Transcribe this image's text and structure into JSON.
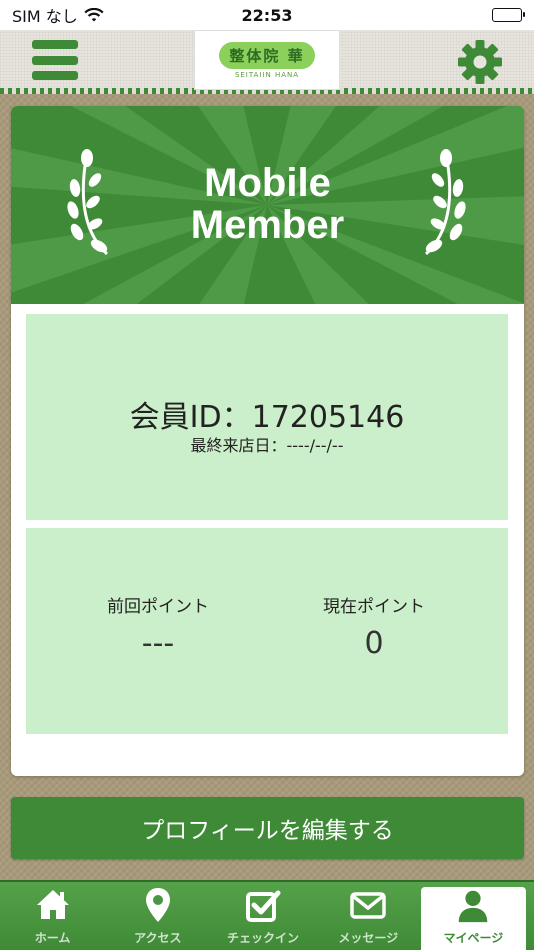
{
  "status_bar": {
    "carrier": "SIM なし",
    "time": "22:53"
  },
  "header": {
    "logo_text": "整体院 華",
    "logo_sub": "SEITAIIN HANA",
    "menu_icon": "hamburger-icon",
    "settings_icon": "gear-icon"
  },
  "banner": {
    "title_line1": "Mobile",
    "title_line2": "Member"
  },
  "member": {
    "id_text": "会員ID：17205146",
    "last_visit_text": "最終来店日：----/--/--"
  },
  "points": {
    "previous_label": "前回ポイント",
    "previous_value": "---",
    "current_label": "現在ポイント",
    "current_value": "0"
  },
  "edit_profile_label": "プロフィールを編集する",
  "tabs": [
    {
      "label": "ホーム",
      "icon": "home-icon"
    },
    {
      "label": "アクセス",
      "icon": "map-pin-icon"
    },
    {
      "label": "チェックイン",
      "icon": "checkbox-icon"
    },
    {
      "label": "メッセージ",
      "icon": "mail-icon"
    },
    {
      "label": "マイページ",
      "icon": "user-icon"
    }
  ],
  "colors": {
    "accent": "#3e8a37",
    "panel": "#ccefcb",
    "active_tab_bg": "#ffffff"
  }
}
